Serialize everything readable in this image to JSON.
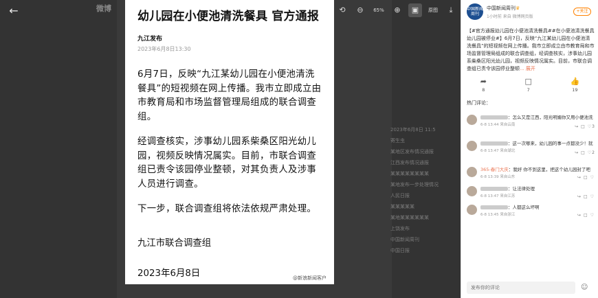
{
  "viewer": {
    "brand": "微博",
    "back_icon": "arrow-left-icon",
    "zoom": "65%",
    "original_label": "原图",
    "bg_left_lines": [],
    "bg_right_rows": [
      "2023年6月8日 11:5",
      "寄生虫",
      "某地区发布情况通报",
      "江西发布情况通报",
      "某某某某某某某某",
      "某地发布一步处理情况",
      "人民日报",
      "某某某某某",
      "某地某某某某某某",
      "上饶发布",
      "中国新闻周刊",
      "中国日报"
    ]
  },
  "document": {
    "title": "幼儿园在小便池清洗餐具 官方通报",
    "source": "九江发布",
    "date": "2023年6月8日13:30",
    "paragraphs": [
      "6月7日，反映“九江某幼儿园在小便池清洗餐具”的短视频在网上传播。我市立即成立由市教育局和市场监督管理局组成的联合调查组。",
      "经调查核实，涉事幼儿园系柴桑区阳光幼儿园，视频反映情况属实。目前，市联合调查组已责令该园停业整顿，对其负责人及涉事人员进行调查。",
      "下一步，联合调查组将依法依规严肃处理。"
    ],
    "signature": "九江市联合调查组",
    "signature_date": "2023年6月8日",
    "watermark": "@新浪新闻客户"
  },
  "panel": {
    "account_name": "中国新闻周刊",
    "account_avatar_text": "中国新闻周刊",
    "account_meta": "1小时前 来自 微博网页版",
    "follow_label": "+关注",
    "post_tag": "#官方通报幼儿园在小便池清洗餐具#",
    "post_body": "【#官方通报幼儿园在小便池清洗餐具##在小便池清洗餐具幼儿园被停业#】6月7日，反映“九江某幼儿园在小便池清洗餐具”的短视频在网上传播。我市立即成立由市教育局和市场监督管理局组成的联合调查组，经调查核实，涉事幼儿园系柴桑区阳光幼儿园，视频反映情况属实。目前，市联合调查组已责令该园停业整顿",
    "post_more": "... 展开",
    "actions": [
      {
        "icon": "share-icon",
        "count": "8"
      },
      {
        "icon": "comment-icon",
        "count": "7"
      },
      {
        "icon": "like-icon",
        "count": "19"
      }
    ],
    "hot_title": "热门评论：",
    "comments": [
      {
        "text": "：怎么又是江西，阳光明媚你又用小便池洗盘",
        "time": "6-8 13:44",
        "loc": "来自云南",
        "likes": "3"
      },
      {
        "text": "：这一次哪来，幼儿园的事一点都没少！就是如此不要了！",
        "time": "6-8 13:47",
        "loc": "来自湖北",
        "likes": "2"
      },
      {
        "text": "：我好 你不到这里，把这个幼儿园封了吧",
        "time": "6-8 13:39",
        "loc": "来自山东",
        "likes": "",
        "uname": "365-春门大庆"
      },
      {
        "text": "：让法律处理",
        "time": "6-8 13:47",
        "loc": "来自江苏",
        "likes": ""
      },
      {
        "text": "：人都这么坏啊",
        "time": "6-8 13:45",
        "loc": "来自浙江",
        "likes": ""
      }
    ],
    "reply_placeholder": "发布你的评论"
  }
}
